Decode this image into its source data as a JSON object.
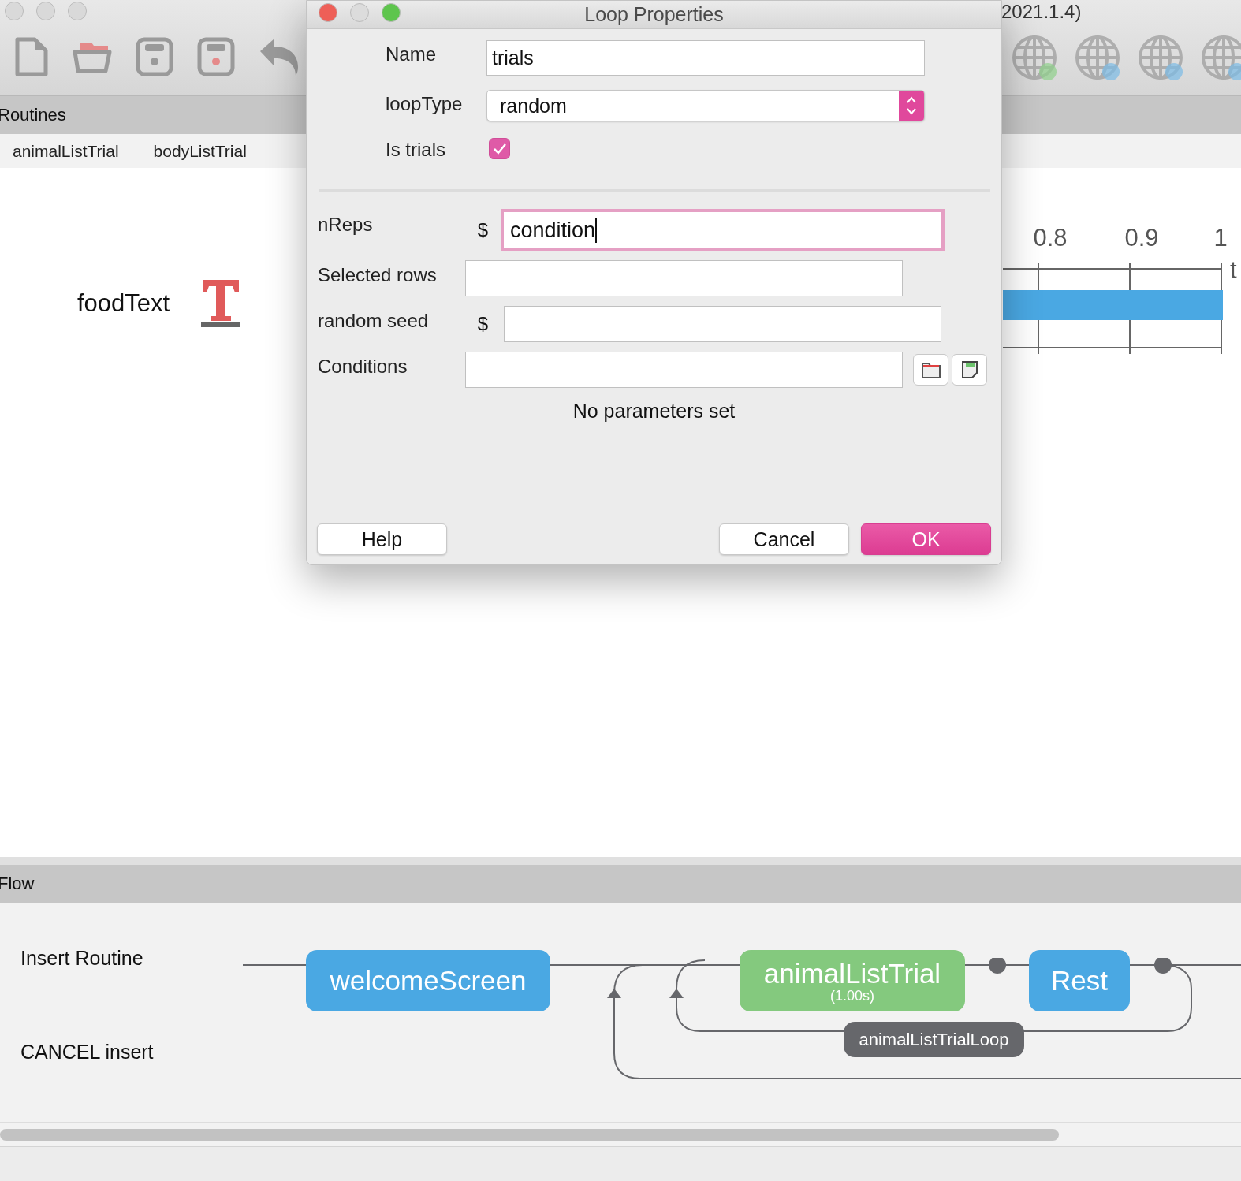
{
  "app": {
    "title": "2021.1.4)"
  },
  "routines": {
    "header": "Routines",
    "tabs": [
      {
        "label": "animalListTrial"
      },
      {
        "label": "bodyListTrial"
      }
    ],
    "components": [
      {
        "name": "foodText"
      }
    ],
    "timeline": {
      "ticks": [
        "0.8",
        "0.9",
        "1"
      ],
      "axis_label": "t"
    }
  },
  "dialog": {
    "title": "Loop Properties",
    "top_fields": [
      {
        "kind": "text",
        "label": "Name",
        "value": "trials"
      },
      {
        "kind": "select",
        "label": "loopType",
        "value": "random"
      },
      {
        "kind": "checkbox",
        "label": "Is trials",
        "checked": true
      }
    ],
    "fields": [
      {
        "kind": "text",
        "label": "nReps",
        "prefix": "$",
        "value": "condition",
        "focused": true
      },
      {
        "kind": "text",
        "label": "Selected rows",
        "focused": false
      },
      {
        "kind": "text",
        "label": "random seed",
        "prefix": "$",
        "focused": false
      },
      {
        "kind": "file",
        "label": "Conditions",
        "focused": false
      }
    ],
    "message": "No parameters set",
    "buttons": [
      {
        "label": "Help",
        "default": false
      },
      {
        "label": "Cancel",
        "default": false
      },
      {
        "label": "OK",
        "default": true
      }
    ]
  },
  "flow": {
    "header": "Flow",
    "actions": [
      "Insert Routine",
      "CANCEL insert"
    ],
    "routines": [
      {
        "label": "welcomeScreen",
        "color": "#4aa8e3"
      },
      {
        "label": "animalListTrial",
        "duration": "(1.00s)",
        "color": "#84c97e"
      },
      {
        "label": "Rest",
        "color": "#4aa8e3"
      }
    ],
    "loops": [
      {
        "label": "animalListTrialLoop"
      }
    ]
  }
}
